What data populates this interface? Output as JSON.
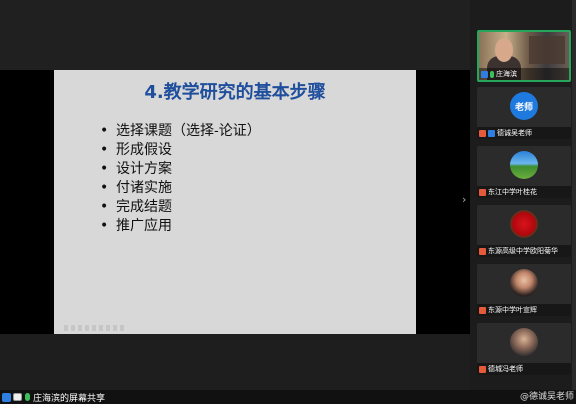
{
  "slide": {
    "title": "4.教学研究的基本步骤",
    "items": [
      "选择课题（选择-论证）",
      "形成假设",
      "设计方案",
      "付诸实施",
      "完成结题",
      "推广应用"
    ]
  },
  "bottom_bar": {
    "sharer_label": "庄海滨的屏幕共享",
    "right_label": "@德诚吴老师"
  },
  "participants": [
    {
      "name": "庄海滨",
      "type": "camera"
    },
    {
      "name": "德诚吴老师",
      "avatar_text": "老师",
      "type": "avatar"
    },
    {
      "name": "东江中学叶桂花",
      "type": "avatar"
    },
    {
      "name": "东源高级中学欧阳菊华",
      "type": "avatar"
    },
    {
      "name": "东源中学叶宣辉",
      "type": "avatar"
    },
    {
      "name": "德城冯老师",
      "type": "avatar"
    }
  ],
  "colors": {
    "title_blue": "#1f4e9c",
    "active_border": "#26a65b",
    "mic_muted": "#e65a3c"
  },
  "icons": {
    "scroll_right": "›",
    "expand": "⌄"
  }
}
